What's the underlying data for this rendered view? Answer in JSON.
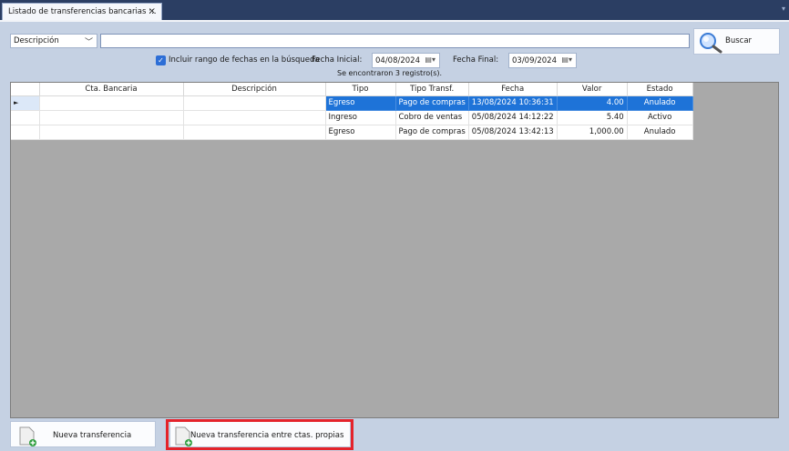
{
  "tab": {
    "title": "Listado de transferencias bancarias ::.",
    "close": "×",
    "menu": "▾"
  },
  "filter": {
    "field": "Descripción",
    "search_value": "",
    "search_button": "Buscar",
    "range_checked": true,
    "range_label": "Incluir rango de fechas en la búsqueda",
    "start_label": "Fecha Inicial:",
    "start_date": "04/08/2024",
    "end_label": "Fecha Final:",
    "end_date": "03/09/2024",
    "results": "Se encontraron 3 registro(s)."
  },
  "grid": {
    "columns": [
      "Cta. Bancaria",
      "Descripción",
      "Tipo",
      "Tipo Transf.",
      "Fecha",
      "Valor",
      "Estado"
    ],
    "rows": [
      {
        "cuenta": "",
        "descripcion": "",
        "tipo": "Egreso",
        "tipo_transf": "Pago de compras",
        "fecha": "13/08/2024 10:36:31",
        "valor": "4.00",
        "estado": "Anulado",
        "selected": true
      },
      {
        "cuenta": "",
        "descripcion": "",
        "tipo": "Ingreso",
        "tipo_transf": "Cobro de ventas",
        "fecha": "05/08/2024 14:12:22",
        "valor": "5.40",
        "estado": "Activo",
        "selected": false
      },
      {
        "cuenta": "",
        "descripcion": "",
        "tipo": "Egreso",
        "tipo_transf": "Pago de compras",
        "fecha": "05/08/2024 13:42:13",
        "valor": "1,000.00",
        "estado": "Anulado",
        "selected": false
      }
    ]
  },
  "actions": {
    "new_transfer": "Nueva transferencia",
    "new_own_transfer": "Nueva transferencia entre ctas. propias"
  },
  "colors": {
    "selection": "#1e73d8",
    "highlight": "#e4232b",
    "title_bar": "#2b3e63"
  },
  "icons": {
    "search": "magnifier-icon",
    "calendar": "calendar-icon",
    "document": "document-add-icon"
  }
}
